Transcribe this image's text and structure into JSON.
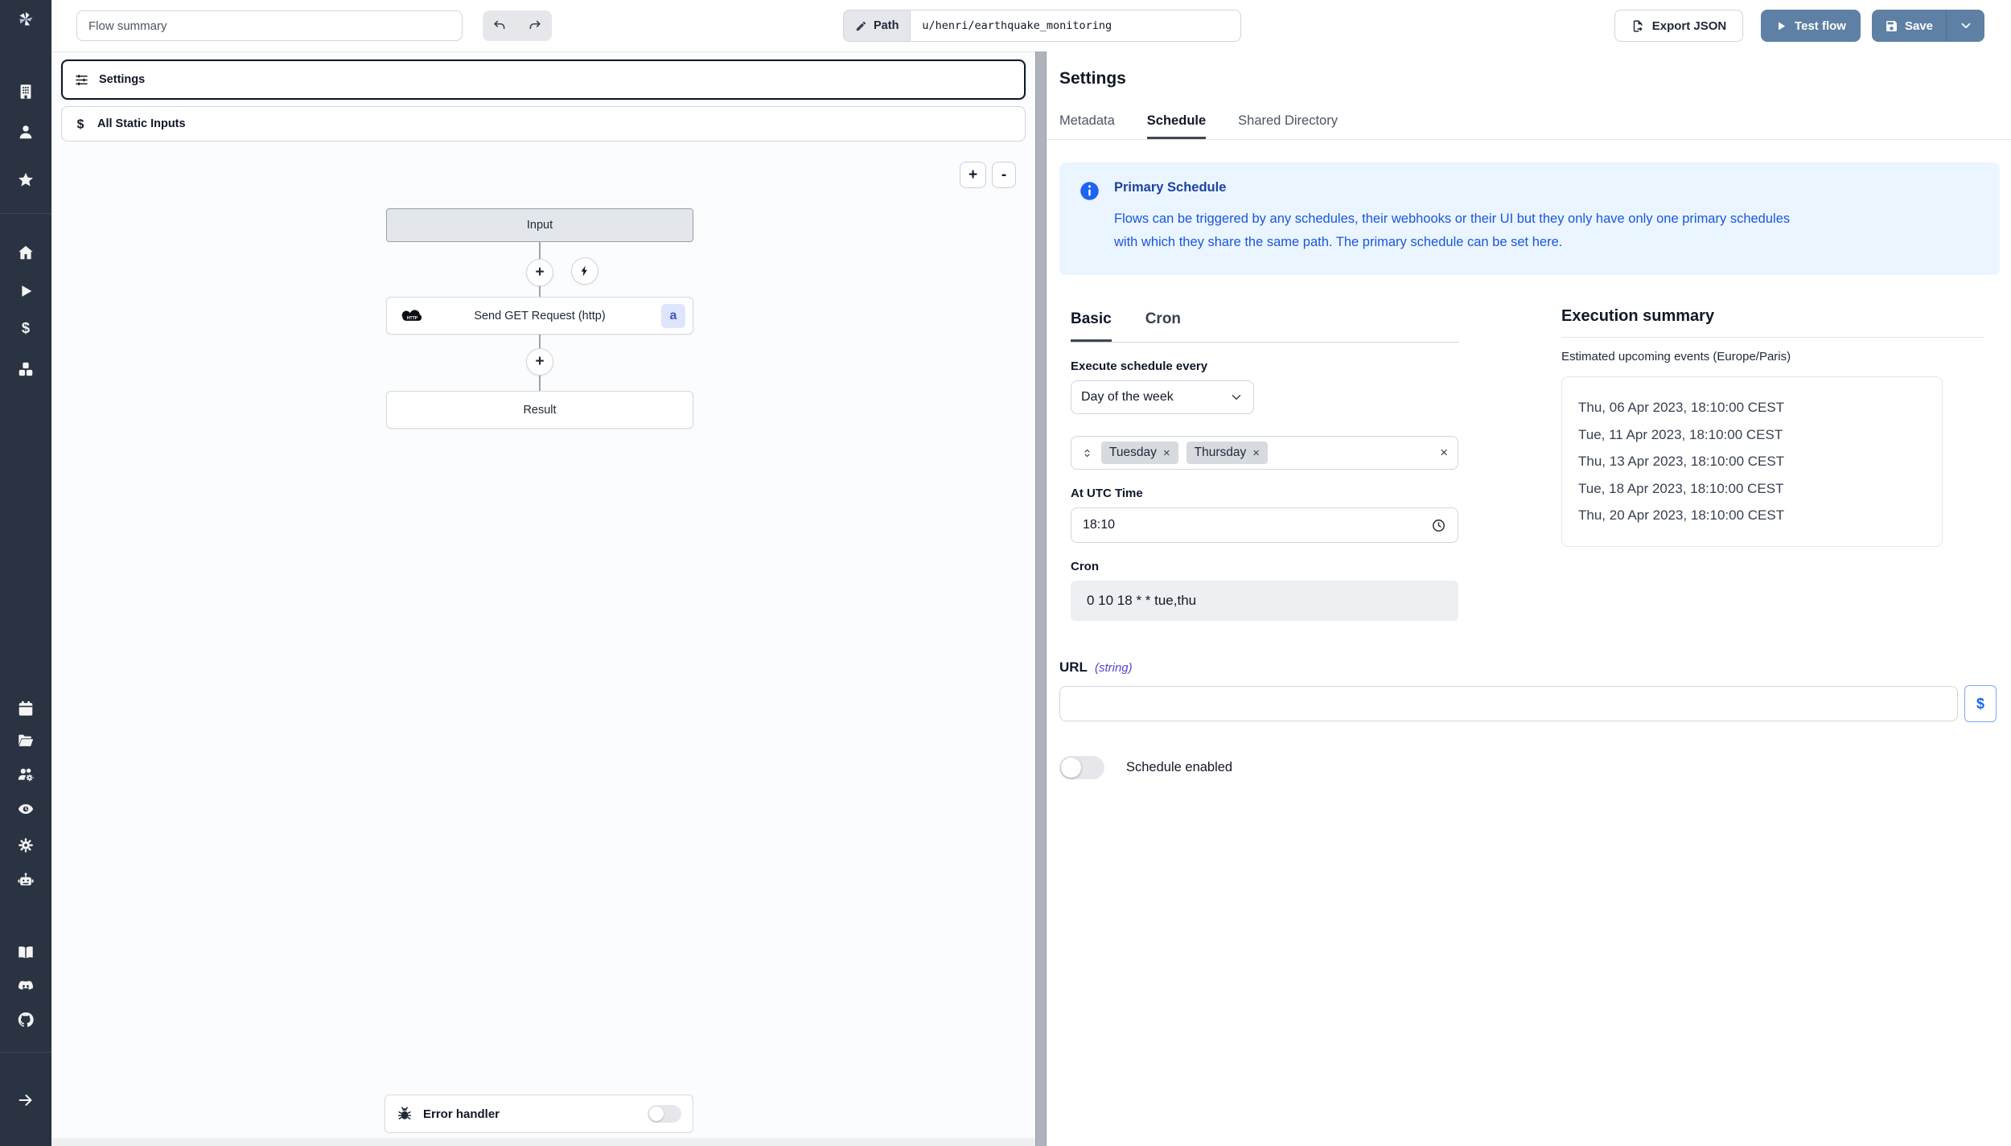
{
  "topbar": {
    "flow_summary_placeholder": "Flow summary",
    "path_label": "Path",
    "path_value": "u/henri/earthquake_monitoring",
    "export_json_label": "Export JSON",
    "test_flow_label": "Test flow",
    "save_label": "Save"
  },
  "flow_panel": {
    "settings_box_label": "Settings",
    "static_inputs_label": "All Static Inputs",
    "zoom_in_label": "+",
    "zoom_out_label": "-",
    "nodes": {
      "input_label": "Input",
      "http_label": "Send GET Request (http)",
      "http_badge": "a",
      "result_label": "Result"
    },
    "error_handler_label": "Error handler"
  },
  "right_panel": {
    "title": "Settings",
    "tabs": [
      {
        "label": "Metadata"
      },
      {
        "label": "Schedule"
      },
      {
        "label": "Shared Directory"
      }
    ],
    "info": {
      "title": "Primary Schedule",
      "line1": "Flows can be triggered by any schedules, their webhooks or their UI but they only have only one primary schedules",
      "line2": "with which they share the same path. The primary schedule can be set here."
    },
    "schedule": {
      "tabs": [
        {
          "label": "Basic"
        },
        {
          "label": "Cron"
        }
      ],
      "execute_label": "Execute schedule every",
      "period_value": "Day of the week",
      "day_tags": [
        "Tuesday",
        "Thursday"
      ],
      "remove_glyph": "×",
      "clear_glyph": "×",
      "at_utc_label": "At UTC Time",
      "time_value": "18:10",
      "cron_label": "Cron",
      "cron_value": "0 10 18 * * tue,thu"
    },
    "execution": {
      "title": "Execution summary",
      "subtitle": "Estimated upcoming events (Europe/Paris)",
      "events": [
        "Thu, 06 Apr 2023, 18:10:00 CEST",
        "Tue, 11 Apr 2023, 18:10:00 CEST",
        "Thu, 13 Apr 2023, 18:10:00 CEST",
        "Tue, 18 Apr 2023, 18:10:00 CEST",
        "Thu, 20 Apr 2023, 18:10:00 CEST"
      ]
    },
    "url": {
      "label": "URL",
      "type_hint": "(string)",
      "value": "",
      "dollar_button": "$"
    },
    "schedule_enabled_label": "Schedule enabled"
  },
  "colors": {
    "accent_blue": "#5e80a4",
    "sidebar_bg": "#2a3342",
    "info_bg": "#ebf5ff",
    "info_title_text": "#1e429f",
    "info_body_text": "#1a56db",
    "badge_bg": "#dfe4fd",
    "badge_text": "#4151c6",
    "selected_border": "#0f172a"
  }
}
